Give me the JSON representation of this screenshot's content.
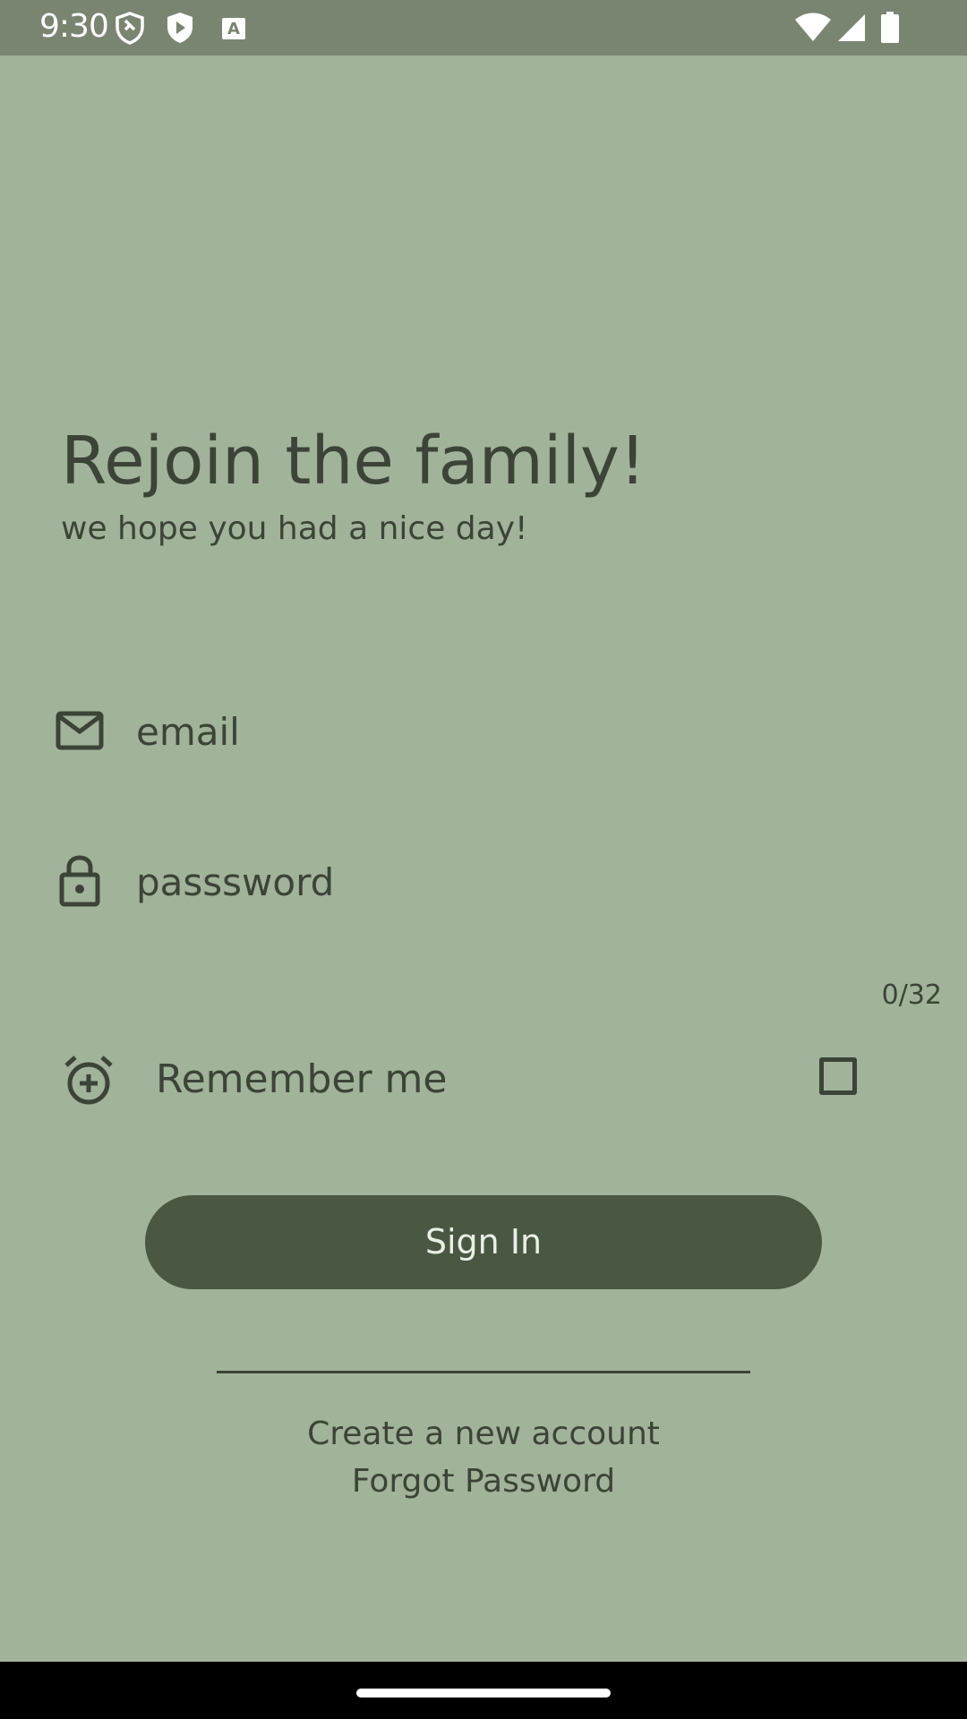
{
  "status_bar": {
    "time": "9:30",
    "icons": [
      "vpn-shield-icon",
      "play-protect-icon",
      "keyboard-a-icon",
      "wifi-icon",
      "cell-signal-icon",
      "battery-icon"
    ]
  },
  "header": {
    "title": "Rejoin the family!",
    "subtitle": "we hope you had a nice day!"
  },
  "form": {
    "email": {
      "icon": "mail-icon",
      "placeholder": "email",
      "value": ""
    },
    "password": {
      "icon": "lock-icon",
      "placeholder": "passsword",
      "value": "",
      "counter": "0/32"
    },
    "remember": {
      "icon": "alarm-add-icon",
      "label": "Remember me",
      "checked": false
    },
    "submit_label": "Sign In"
  },
  "links": {
    "create_account": "Create a new account",
    "forgot_password": "Forgot Password"
  },
  "colors": {
    "background": "#a1b39a",
    "status_bar": "#798571",
    "text": "#3b4437",
    "button": "#4a5743",
    "button_text": "#e9efe4"
  }
}
